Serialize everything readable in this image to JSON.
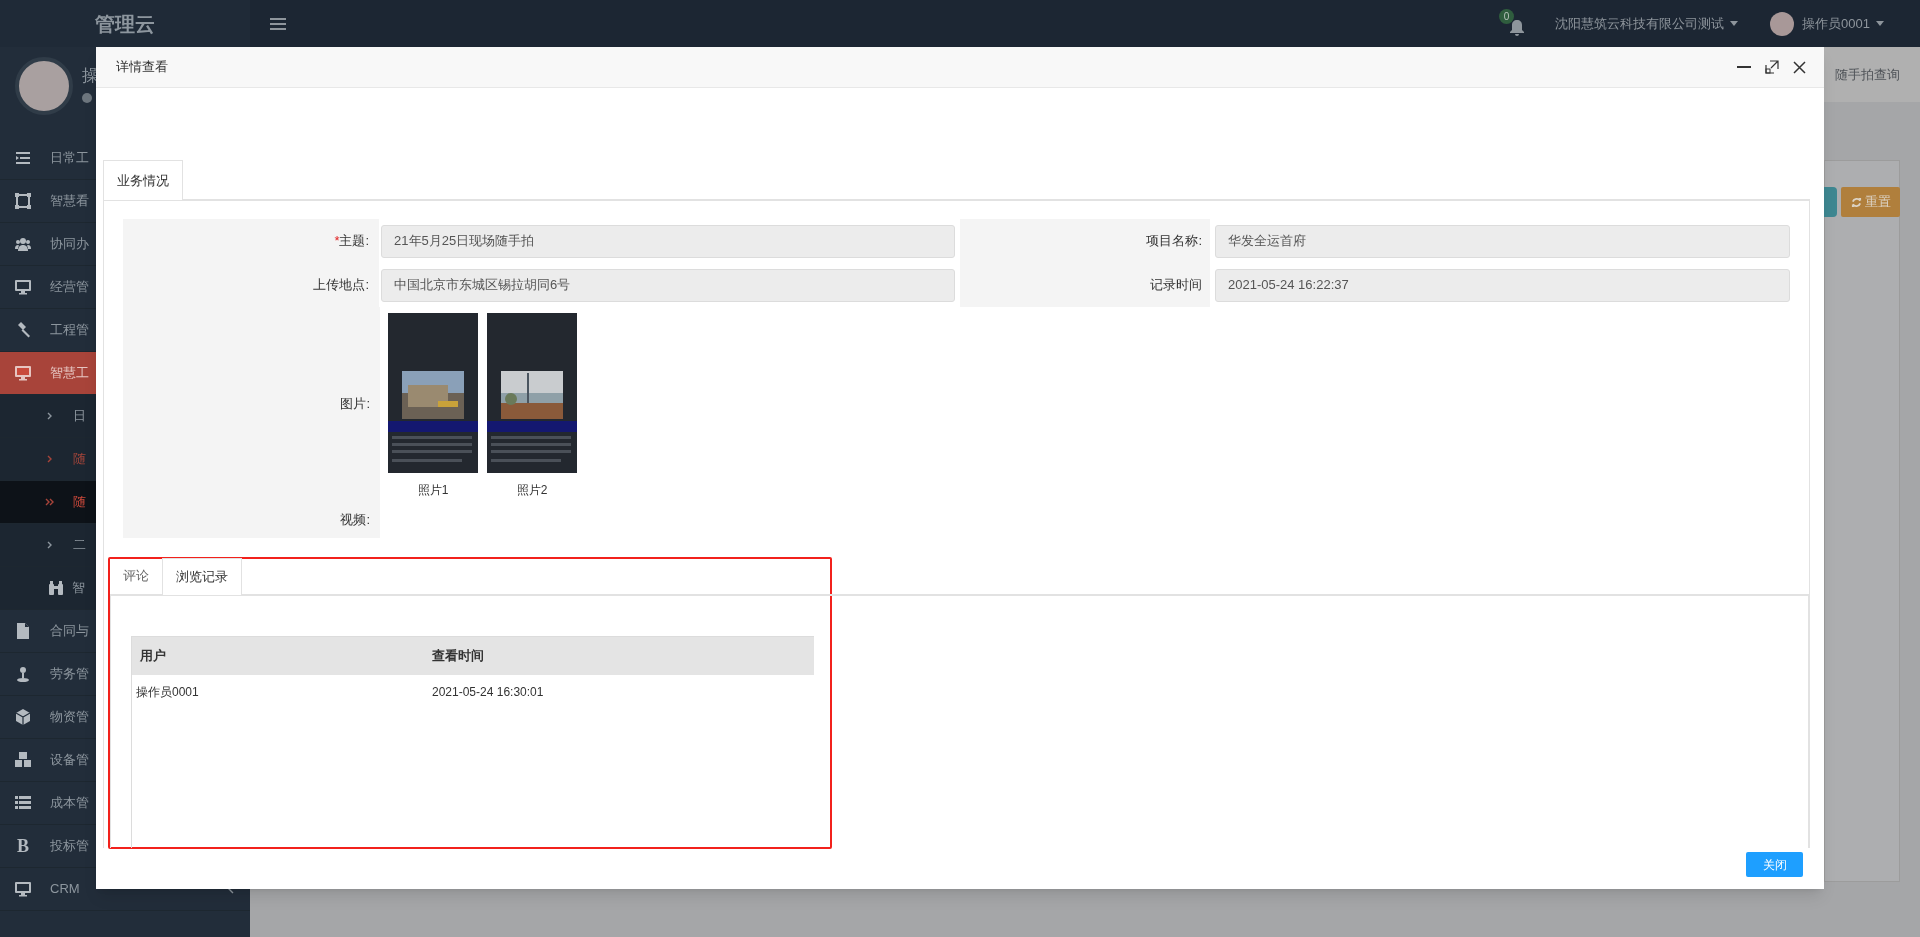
{
  "app": {
    "logo": "管理云",
    "user_name_visible": "操",
    "notifications": "0",
    "company": "沈阳慧筑云科技有限公司测试",
    "user": "操作员0001"
  },
  "sidebar": {
    "items": [
      {
        "label": "日常工",
        "kind": "menu",
        "selected": false,
        "expanded": false
      },
      {
        "label": "智慧看",
        "kind": "menu",
        "selected": false,
        "expanded": false
      },
      {
        "label": "协同办",
        "kind": "menu",
        "selected": false,
        "expanded": false
      },
      {
        "label": "经营管",
        "kind": "menu",
        "selected": false,
        "expanded": false
      },
      {
        "label": "工程管",
        "kind": "menu",
        "selected": false,
        "expanded": false
      },
      {
        "label": "智慧工",
        "kind": "menu",
        "selected": false,
        "expanded": true
      },
      {
        "label": "日",
        "kind": "submenu",
        "selected": false,
        "expanded": false
      },
      {
        "label": "随",
        "kind": "submenu",
        "selected": false,
        "expanded": true
      },
      {
        "label": "随",
        "kind": "submenu",
        "selected": true,
        "expanded": false
      },
      {
        "label": "二",
        "kind": "submenu",
        "selected": false,
        "expanded": false
      },
      {
        "label": "智",
        "kind": "group-menu",
        "selected": false,
        "expanded": false
      },
      {
        "label": "合同与",
        "kind": "menu",
        "selected": false,
        "expanded": false
      },
      {
        "label": "劳务管",
        "kind": "menu",
        "selected": false,
        "expanded": false
      },
      {
        "label": "物资管",
        "kind": "menu",
        "selected": false,
        "expanded": false
      },
      {
        "label": "设备管",
        "kind": "menu",
        "selected": false,
        "expanded": false
      },
      {
        "label": "成本管",
        "kind": "menu",
        "selected": false,
        "expanded": false
      },
      {
        "label": "投标管",
        "kind": "menu",
        "selected": false,
        "expanded": false,
        "glyph": "B"
      },
      {
        "label": "CRM",
        "kind": "menu",
        "selected": false,
        "expanded": false
      }
    ]
  },
  "background": {
    "breadcrumb": "随手拍查询",
    "reset_button": "重置"
  },
  "dialog": {
    "title": "详情查看",
    "tabs": [
      {
        "label": "业务情况",
        "selected": true
      }
    ],
    "form": {
      "left": [
        {
          "label": "主题:",
          "required_mark": "*",
          "value": "21年5月25日现场随手拍"
        },
        {
          "label": "上传地点:",
          "value": "中国北京市东城区锡拉胡同6号"
        }
      ],
      "right": [
        {
          "label": "项目名称:",
          "value": "华发全运首府"
        },
        {
          "label": "记录时间",
          "value": "2021-05-24 16:22:37"
        }
      ],
      "pictures_label": "图片:",
      "pictures": [
        {
          "caption": "照片1",
          "kind": "picture"
        },
        {
          "caption": "照片2",
          "kind": "picture"
        }
      ],
      "video_label": "视频:"
    },
    "sub_tabs": [
      {
        "label": "评论",
        "selected": false
      },
      {
        "label": "浏览记录",
        "selected": true
      }
    ],
    "table": {
      "columns": [
        "用户",
        "查看时间"
      ],
      "rows": [
        [
          "操作员0001",
          "2021-05-24 16:30:01"
        ]
      ]
    },
    "close_button": "关闭"
  }
}
